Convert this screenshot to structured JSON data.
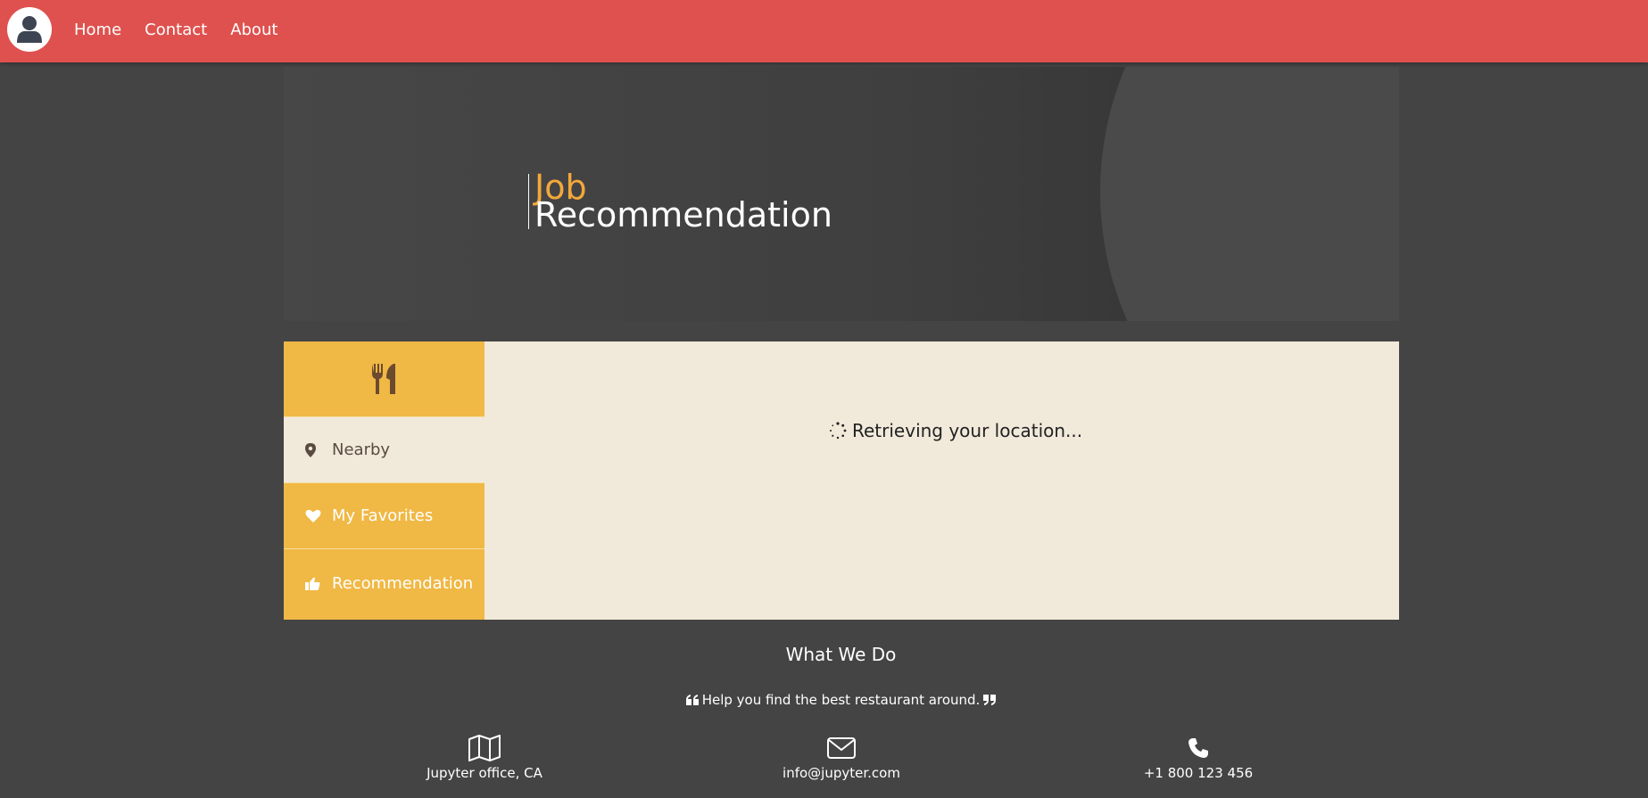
{
  "nav": {
    "links": [
      "Home",
      "Contact",
      "About"
    ]
  },
  "hero": {
    "title_line1": "Job",
    "title_line2": "Recommendation"
  },
  "sidebar": {
    "top_icon": "utensils-icon",
    "items": [
      {
        "label": "Nearby",
        "icon": "map-marker-icon",
        "active": true
      },
      {
        "label": "My Favorites",
        "icon": "heart-icon",
        "active": false
      },
      {
        "label": "Recommendation",
        "icon": "thumbs-up-icon",
        "active": false
      }
    ]
  },
  "content": {
    "status": "Retrieving your location..."
  },
  "footer": {
    "heading": "What We Do",
    "tagline": "Help you find the best restaurant around.",
    "contacts": [
      {
        "icon": "map-icon",
        "text": "Jupyter office, CA"
      },
      {
        "icon": "envelope-icon",
        "text": "info@jupyter.com"
      },
      {
        "icon": "phone-icon",
        "text": "+1 800 123 456"
      }
    ]
  },
  "colors": {
    "nav_bg": "#df514e",
    "page_bg": "#444444",
    "accent": "#f0b844",
    "title_accent": "#f3a83a",
    "panel_bg": "#f1eadb"
  }
}
